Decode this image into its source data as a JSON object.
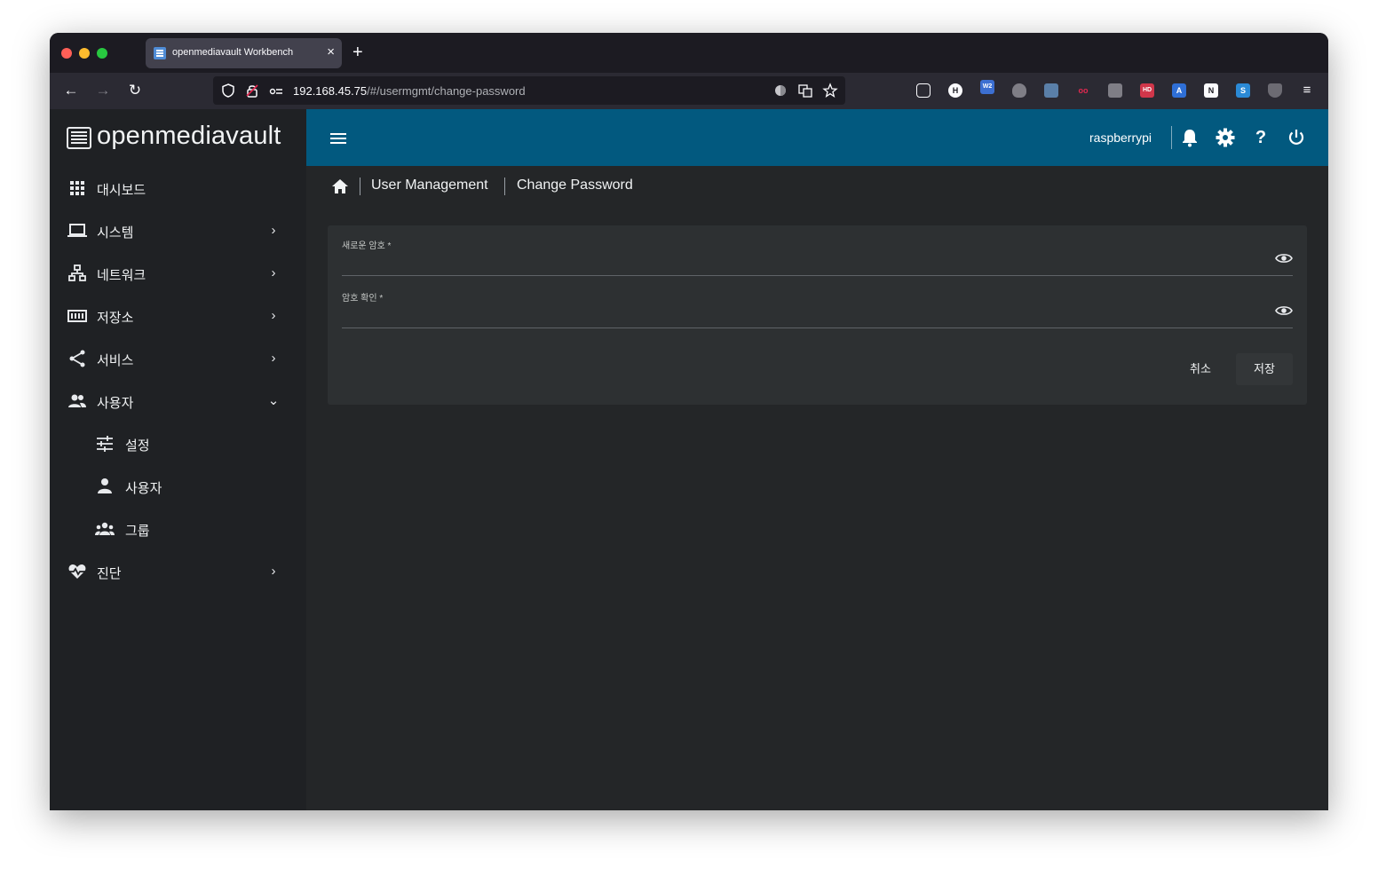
{
  "browser": {
    "tab_title": "openmediavault Workbench",
    "tab_close": "×",
    "new_tab": "+",
    "url_host": "192.168.45.75",
    "url_path": "/#/usermgmt/change-password",
    "back": "←",
    "forward": "→",
    "reload": "↻"
  },
  "brand": {
    "name": "openmediavault"
  },
  "sidebar": {
    "items": [
      {
        "label": "대시보드",
        "icon": "apps-grid-icon"
      },
      {
        "label": "시스템",
        "icon": "laptop-icon"
      },
      {
        "label": "네트워크",
        "icon": "network-icon"
      },
      {
        "label": "저장소",
        "icon": "storage-icon"
      },
      {
        "label": "서비스",
        "icon": "share-icon"
      },
      {
        "label": "사용자",
        "icon": "users-icon",
        "expanded": true
      },
      {
        "label": "진단",
        "icon": "heart-pulse-icon"
      }
    ],
    "subitems": [
      {
        "label": "설정",
        "icon": "tune-icon"
      },
      {
        "label": "사용자",
        "icon": "person-icon"
      },
      {
        "label": "그룹",
        "icon": "group-icon"
      }
    ]
  },
  "topbar": {
    "hostname": "raspberrypi"
  },
  "breadcrumb": {
    "items": [
      "User Management",
      "Change Password"
    ]
  },
  "form": {
    "new_password_label": "새로운 암호 *",
    "new_password_value": "",
    "confirm_password_label": "암호 확인 *",
    "confirm_password_value": "",
    "cancel_label": "취소",
    "save_label": "저장"
  },
  "colors": {
    "topbar": "#02597f",
    "sidebar": "#1f2124",
    "content": "#242628",
    "card": "#2d3032"
  }
}
